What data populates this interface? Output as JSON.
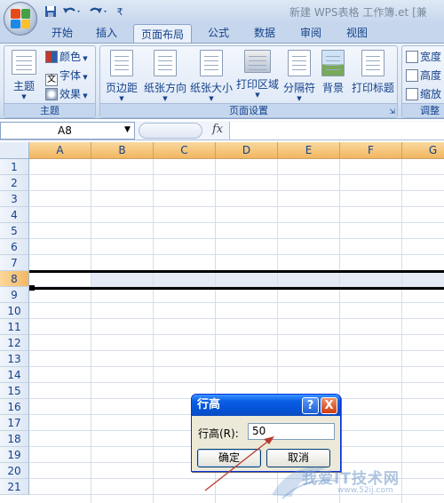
{
  "window": {
    "title": "新建 WPS表格 工作簿.et [兼"
  },
  "quick_access": {
    "save_icon": "save-icon",
    "undo_icon": "undo-icon",
    "redo_icon": "redo-icon",
    "customize_glyph": "₹"
  },
  "tabs": [
    {
      "label": "开始",
      "active": false
    },
    {
      "label": "插入",
      "active": false
    },
    {
      "label": "页面布局",
      "active": true
    },
    {
      "label": "公式",
      "active": false
    },
    {
      "label": "数据",
      "active": false
    },
    {
      "label": "审阅",
      "active": false
    },
    {
      "label": "视图",
      "active": false
    }
  ],
  "ribbon": {
    "theme_group": {
      "label": "主题",
      "theme_button": "主题",
      "colors": "颜色",
      "fonts": "字体",
      "effects": "效果"
    },
    "page_setup_group": {
      "label": "页面设置",
      "margins": "页边距",
      "orientation": "纸张方向",
      "size": "纸张大小",
      "print_area": "打印区域",
      "breaks": "分隔符",
      "background": "背景",
      "print_titles": "打印标题"
    },
    "scale_group": {
      "label": "调整",
      "width": "宽度",
      "height": "高度",
      "scale": "缩放"
    }
  },
  "formula_bar": {
    "name_box": "A8",
    "fx": "fx",
    "formula": ""
  },
  "sheet": {
    "columns": [
      "A",
      "B",
      "C",
      "D",
      "E",
      "F",
      "G"
    ],
    "rows": [
      "1",
      "2",
      "3",
      "4",
      "5",
      "6",
      "7",
      "8",
      "9",
      "10",
      "11",
      "12",
      "13",
      "14",
      "15",
      "16",
      "17",
      "18",
      "19",
      "20",
      "21"
    ],
    "selected_row": "8",
    "active_cell": "A8"
  },
  "dialog": {
    "title": "行高",
    "help": "?",
    "close": "X",
    "field_label": "行高(R):",
    "value": "50",
    "ok": "确定",
    "cancel": "取消"
  },
  "watermark": {
    "text": "我爱IT技术网",
    "sub": "www.52ij.com"
  },
  "colors": {
    "header_selected": "#f3b763",
    "dialog_title": "#0452d6",
    "accent": "#15428b"
  }
}
